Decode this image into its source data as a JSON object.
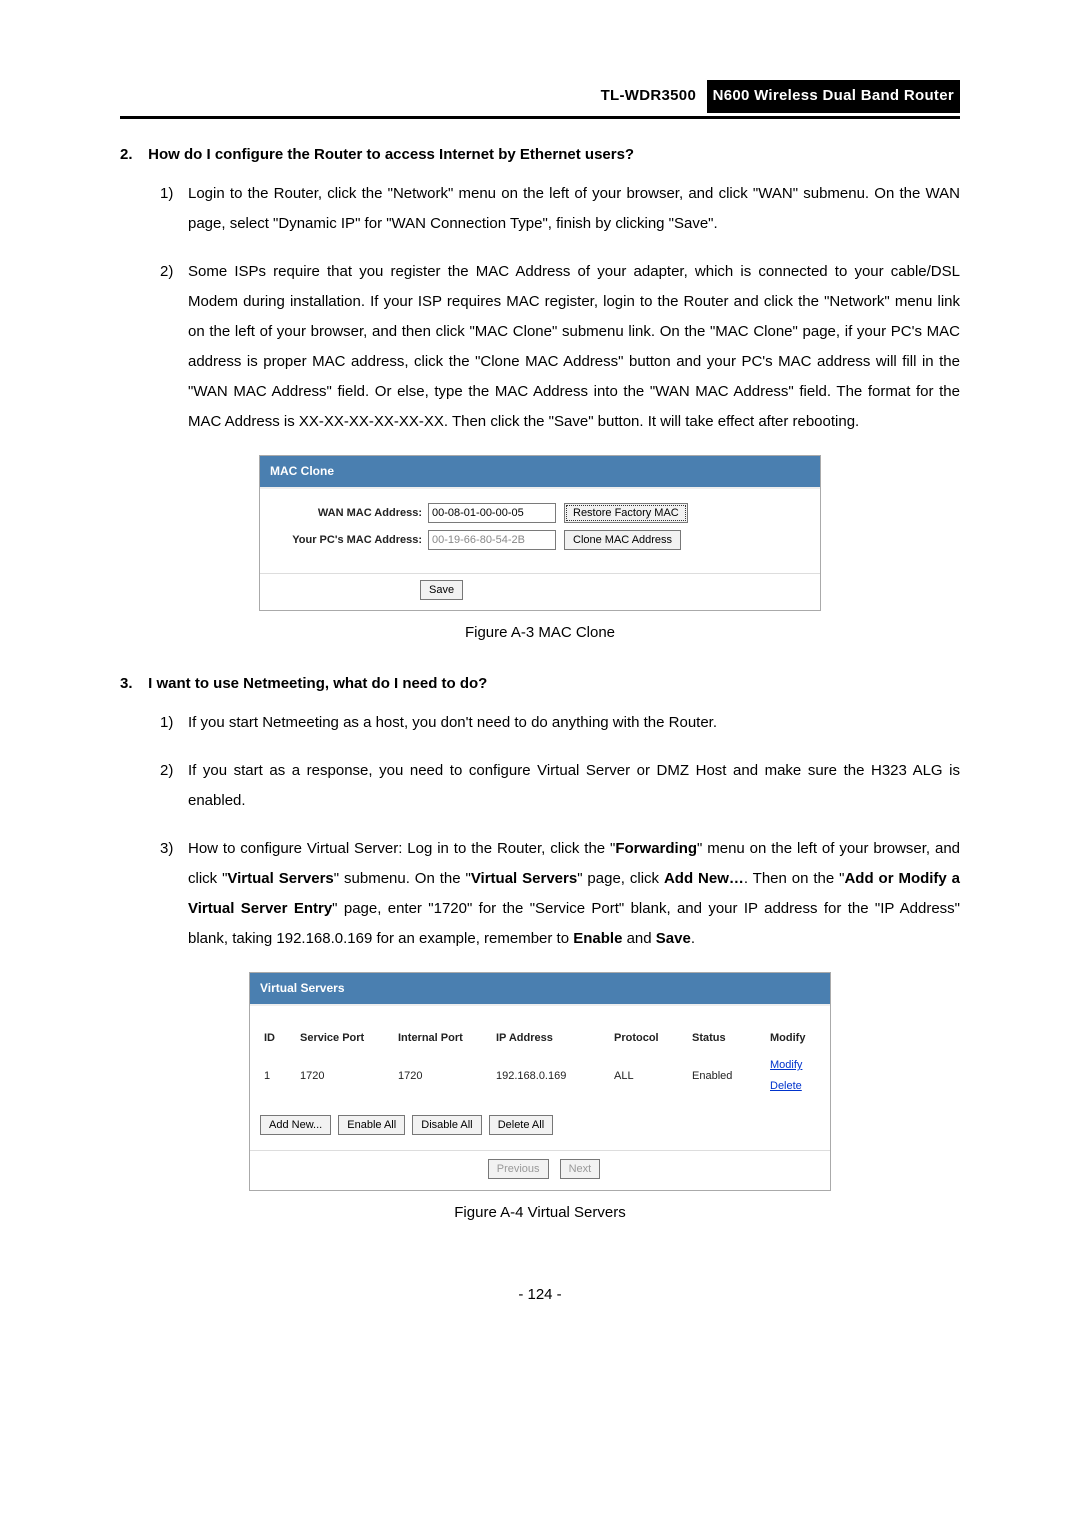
{
  "header": {
    "model": "TL-WDR3500",
    "router": "N600 Wireless Dual Band Router"
  },
  "q2": {
    "num": "2.",
    "title": "How do I configure the Router to access Internet by Ethernet users?",
    "items": [
      {
        "num": "1)",
        "text": "Login to the Router, click the \"Network\" menu on the left of your browser, and click \"WAN\" submenu. On the WAN page, select \"Dynamic IP\" for \"WAN Connection Type\", finish by clicking \"Save\"."
      },
      {
        "num": "2)",
        "text": "Some ISPs require that you register the MAC Address of your adapter, which is connected to your cable/DSL Modem during installation. If your ISP requires MAC register, login to the Router and click the \"Network\" menu link on the left of your browser, and then click \"MAC Clone\" submenu link. On the \"MAC Clone\" page, if your PC's MAC address is proper MAC address, click the \"Clone MAC Address\" button and your PC's MAC address will fill in the \"WAN MAC Address\" field. Or else, type the MAC Address into the \"WAN MAC Address\" field. The format for the MAC Address is XX-XX-XX-XX-XX-XX. Then click the \"Save\" button. It will take effect after rebooting."
      }
    ]
  },
  "macClone": {
    "title": "MAC Clone",
    "wanLabel": "WAN MAC Address:",
    "wanValue": "00-08-01-00-00-05",
    "restoreBtn": "Restore Factory MAC",
    "pcLabel": "Your PC's MAC Address:",
    "pcValue": "00-19-66-80-54-2B",
    "cloneBtn": "Clone MAC Address",
    "saveBtn": "Save",
    "caption": "Figure A-3 MAC Clone"
  },
  "q3": {
    "num": "3.",
    "title": "I want to use Netmeeting, what do I need to do?",
    "items": [
      {
        "num": "1)",
        "text": "If you start Netmeeting as a host, you don't need to do anything with the Router."
      },
      {
        "num": "2)",
        "text": "If you start as a response, you need to configure Virtual Server or DMZ Host and make sure the H323 ALG is enabled."
      }
    ],
    "item3": {
      "num": "3)",
      "pre": "How to configure Virtual Server: Log in to the Router, click the \"",
      "forwarding": "Forwarding",
      "mid1": "\" menu on the left of your browser, and click \"",
      "vs1": "Virtual Servers",
      "mid2": "\" submenu. On the \"",
      "vs2": "Virtual Servers",
      "mid3": "\" page, click ",
      "addNew": "Add New…",
      "mid4": ". Then on the \"",
      "addModify": "Add or Modify a Virtual Server Entry",
      "mid5": "\" page, enter \"1720\" for the \"Service Port\" blank, and your IP address for the \"IP Address\" blank, taking 192.168.0.169 for an example, remember to ",
      "enable": "Enable",
      "and": " and ",
      "save": "Save",
      "end": "."
    }
  },
  "virtualServers": {
    "title": "Virtual Servers",
    "headers": {
      "id": "ID",
      "servicePort": "Service Port",
      "internalPort": "Internal Port",
      "ipAddress": "IP Address",
      "protocol": "Protocol",
      "status": "Status",
      "modify": "Modify"
    },
    "row": {
      "id": "1",
      "servicePort": "1720",
      "internalPort": "1720",
      "ipAddress": "192.168.0.169",
      "protocol": "ALL",
      "status": "Enabled",
      "modifyLink": "Modify",
      "deleteLink": "Delete"
    },
    "buttons": {
      "addNew": "Add New...",
      "enableAll": "Enable All",
      "disableAll": "Disable All",
      "deleteAll": "Delete All",
      "previous": "Previous",
      "next": "Next"
    },
    "caption": "Figure A-4 Virtual Servers"
  },
  "pageNumber": "- 124 -"
}
